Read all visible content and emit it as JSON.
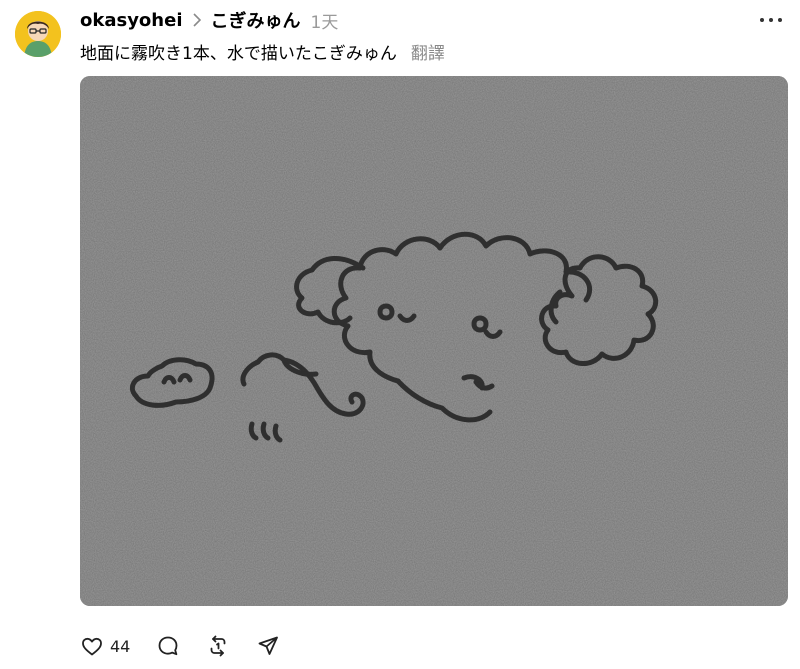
{
  "post": {
    "username": "okasyohei",
    "thread_name": "こぎみゅん",
    "time": "1天",
    "caption": "地面に霧吹き1本、水で描いたこぎみゅん",
    "translate_label": "翻譯"
  },
  "actions": {
    "like_count": "44"
  },
  "icons": {
    "chevron": "chevron-right-icon",
    "more": "more-dots-icon",
    "like": "heart-icon",
    "comment": "comment-bubble-icon",
    "repost": "repost-icon",
    "share": "send-icon"
  },
  "colors": {
    "avatar_bg": "#f3c21e",
    "muted_text": "#9a9a9a",
    "pavement": "#8f8f8f",
    "water_drawing": "#262626"
  }
}
